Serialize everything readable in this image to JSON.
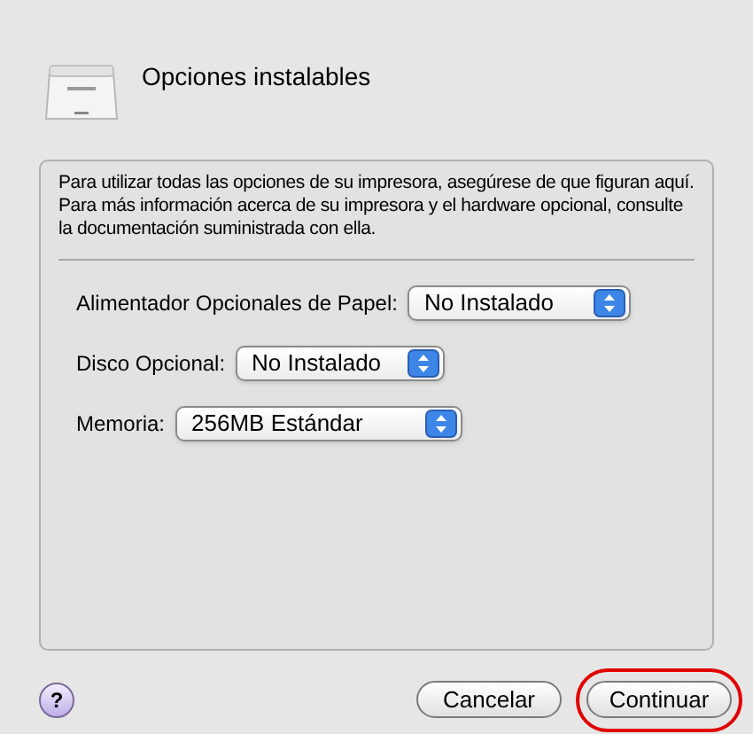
{
  "sheet": {
    "title": "Opciones instalables",
    "description": "Para utilizar todas las opciones de su impresora, asegúrese de que figuran aquí. Para más información acerca de su impresora y el hardware opcional, consulte la documentación suministrada con ella."
  },
  "options": [
    {
      "label": "Alimentador Opcionales de Papel:",
      "value": "No Instalado"
    },
    {
      "label": "Disco Opcional:",
      "value": "No Instalado"
    },
    {
      "label": "Memoria:",
      "value": "256MB Estándar"
    }
  ],
  "help": {
    "label": "?"
  },
  "buttons": [
    {
      "label": "Cancelar",
      "highlighted": false
    },
    {
      "label": "Continuar",
      "highlighted": true
    }
  ]
}
